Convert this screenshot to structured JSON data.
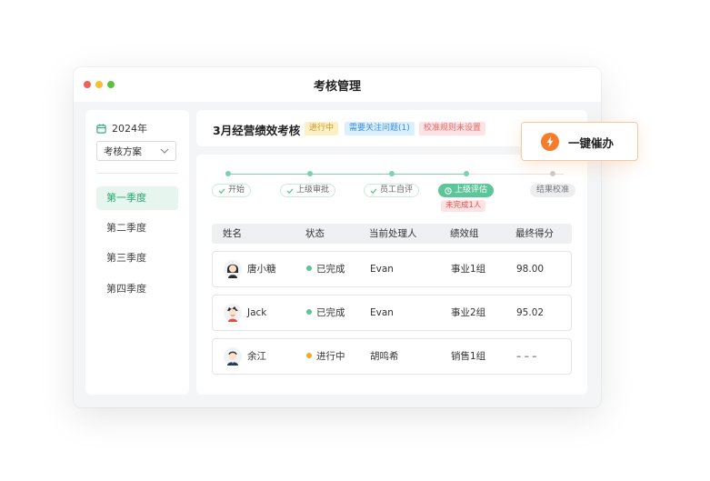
{
  "window": {
    "title": "考核管理"
  },
  "sidebar": {
    "year": "2024年",
    "plan_select": "考核方案",
    "quarters": [
      {
        "label": "第一季度",
        "active": true
      },
      {
        "label": "第二季度",
        "active": false
      },
      {
        "label": "第三季度",
        "active": false
      },
      {
        "label": "第四季度",
        "active": false
      }
    ]
  },
  "header": {
    "title": "3月经营绩效考核",
    "badges": [
      "进行中",
      "需要关注问题(1)",
      "校准规则未设置"
    ]
  },
  "steps": [
    {
      "label": "开始",
      "status": "done"
    },
    {
      "label": "上级审批",
      "status": "done"
    },
    {
      "label": "员工自评",
      "status": "done"
    },
    {
      "label": "上级评估",
      "status": "active",
      "note": "未完成1人"
    },
    {
      "label": "结果校准",
      "status": "pending"
    }
  ],
  "table": {
    "headers": [
      "姓名",
      "状态",
      "当前处理人",
      "绩效组",
      "最终得分"
    ],
    "rows": [
      {
        "name": "唐小糖",
        "status": "已完成",
        "status_color": "#5cc59a",
        "handler": "Evan",
        "group": "事业1组",
        "score": "98.00"
      },
      {
        "name": "Jack",
        "status": "已完成",
        "status_color": "#5cc59a",
        "handler": "Evan",
        "group": "事业2组",
        "score": "95.02"
      },
      {
        "name": "余江",
        "status": "进行中",
        "status_color": "#f5a623",
        "handler": "胡鸣希",
        "group": "销售1组",
        "score": "– – –"
      }
    ]
  },
  "float_action": {
    "label": "一键催办",
    "icon": "lightning-icon"
  },
  "colors": {
    "accent": "#5cc59a",
    "warning": "#f57c2b"
  }
}
